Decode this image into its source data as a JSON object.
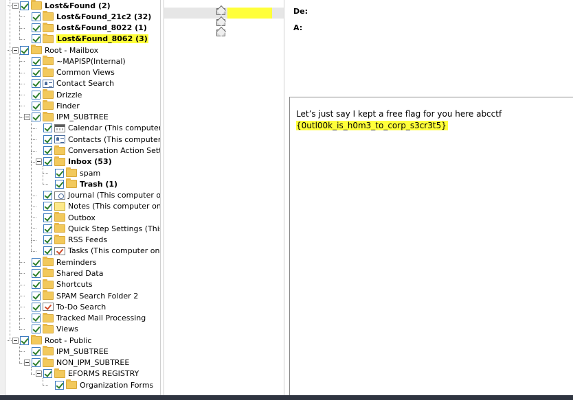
{
  "tree": {
    "items": [
      {
        "label": "Lost&Found (2)",
        "bold": true
      },
      {
        "label": "Lost&Found_21c2 (32)",
        "bold": true
      },
      {
        "label": "Lost&Found_8022 (1)",
        "bold": true
      },
      {
        "label": "Lost&Found_8062 (3)",
        "bold": true,
        "highlight": true
      },
      {
        "label": "Root - Mailbox"
      },
      {
        "label": "~MAPISP(Internal)"
      },
      {
        "label": "Common Views"
      },
      {
        "label": "Contact Search"
      },
      {
        "label": "Drizzle"
      },
      {
        "label": "Finder"
      },
      {
        "label": "IPM_SUBTREE"
      },
      {
        "label": "Calendar (This computer"
      },
      {
        "label": "Contacts (This computer"
      },
      {
        "label": "Conversation Action Sett"
      },
      {
        "label": "Inbox (53)",
        "bold": true
      },
      {
        "label": "spam"
      },
      {
        "label": "Trash (1)",
        "bold": true
      },
      {
        "label": "Journal (This computer o"
      },
      {
        "label": "Notes (This computer on"
      },
      {
        "label": "Outbox"
      },
      {
        "label": "Quick Step Settings (This"
      },
      {
        "label": "RSS Feeds"
      },
      {
        "label": "Tasks (This computer onl"
      },
      {
        "label": "Reminders"
      },
      {
        "label": "Shared Data"
      },
      {
        "label": "Shortcuts"
      },
      {
        "label": "SPAM Search Folder 2"
      },
      {
        "label": "To-Do Search"
      },
      {
        "label": "Tracked Mail Processing"
      },
      {
        "label": "Views"
      },
      {
        "label": "Root - Public"
      },
      {
        "label": "IPM_SUBTREE"
      },
      {
        "label": "NON_IPM_SUBTREE"
      },
      {
        "label": "EFORMS REGISTRY",
        "bold": false
      },
      {
        "label": "Organization Forms"
      }
    ]
  },
  "reading": {
    "to_label": "De:",
    "cc_label": "A:",
    "body_line1": "Let’s just say I kept a free flag for you here abcctf",
    "body_line2": "{0utl00k_is_h0m3_to_corp_s3cr3t5}"
  },
  "colors": {
    "highlight": "#ffff3a",
    "folder": "#f2c95c",
    "check": "#2a7d2a"
  }
}
